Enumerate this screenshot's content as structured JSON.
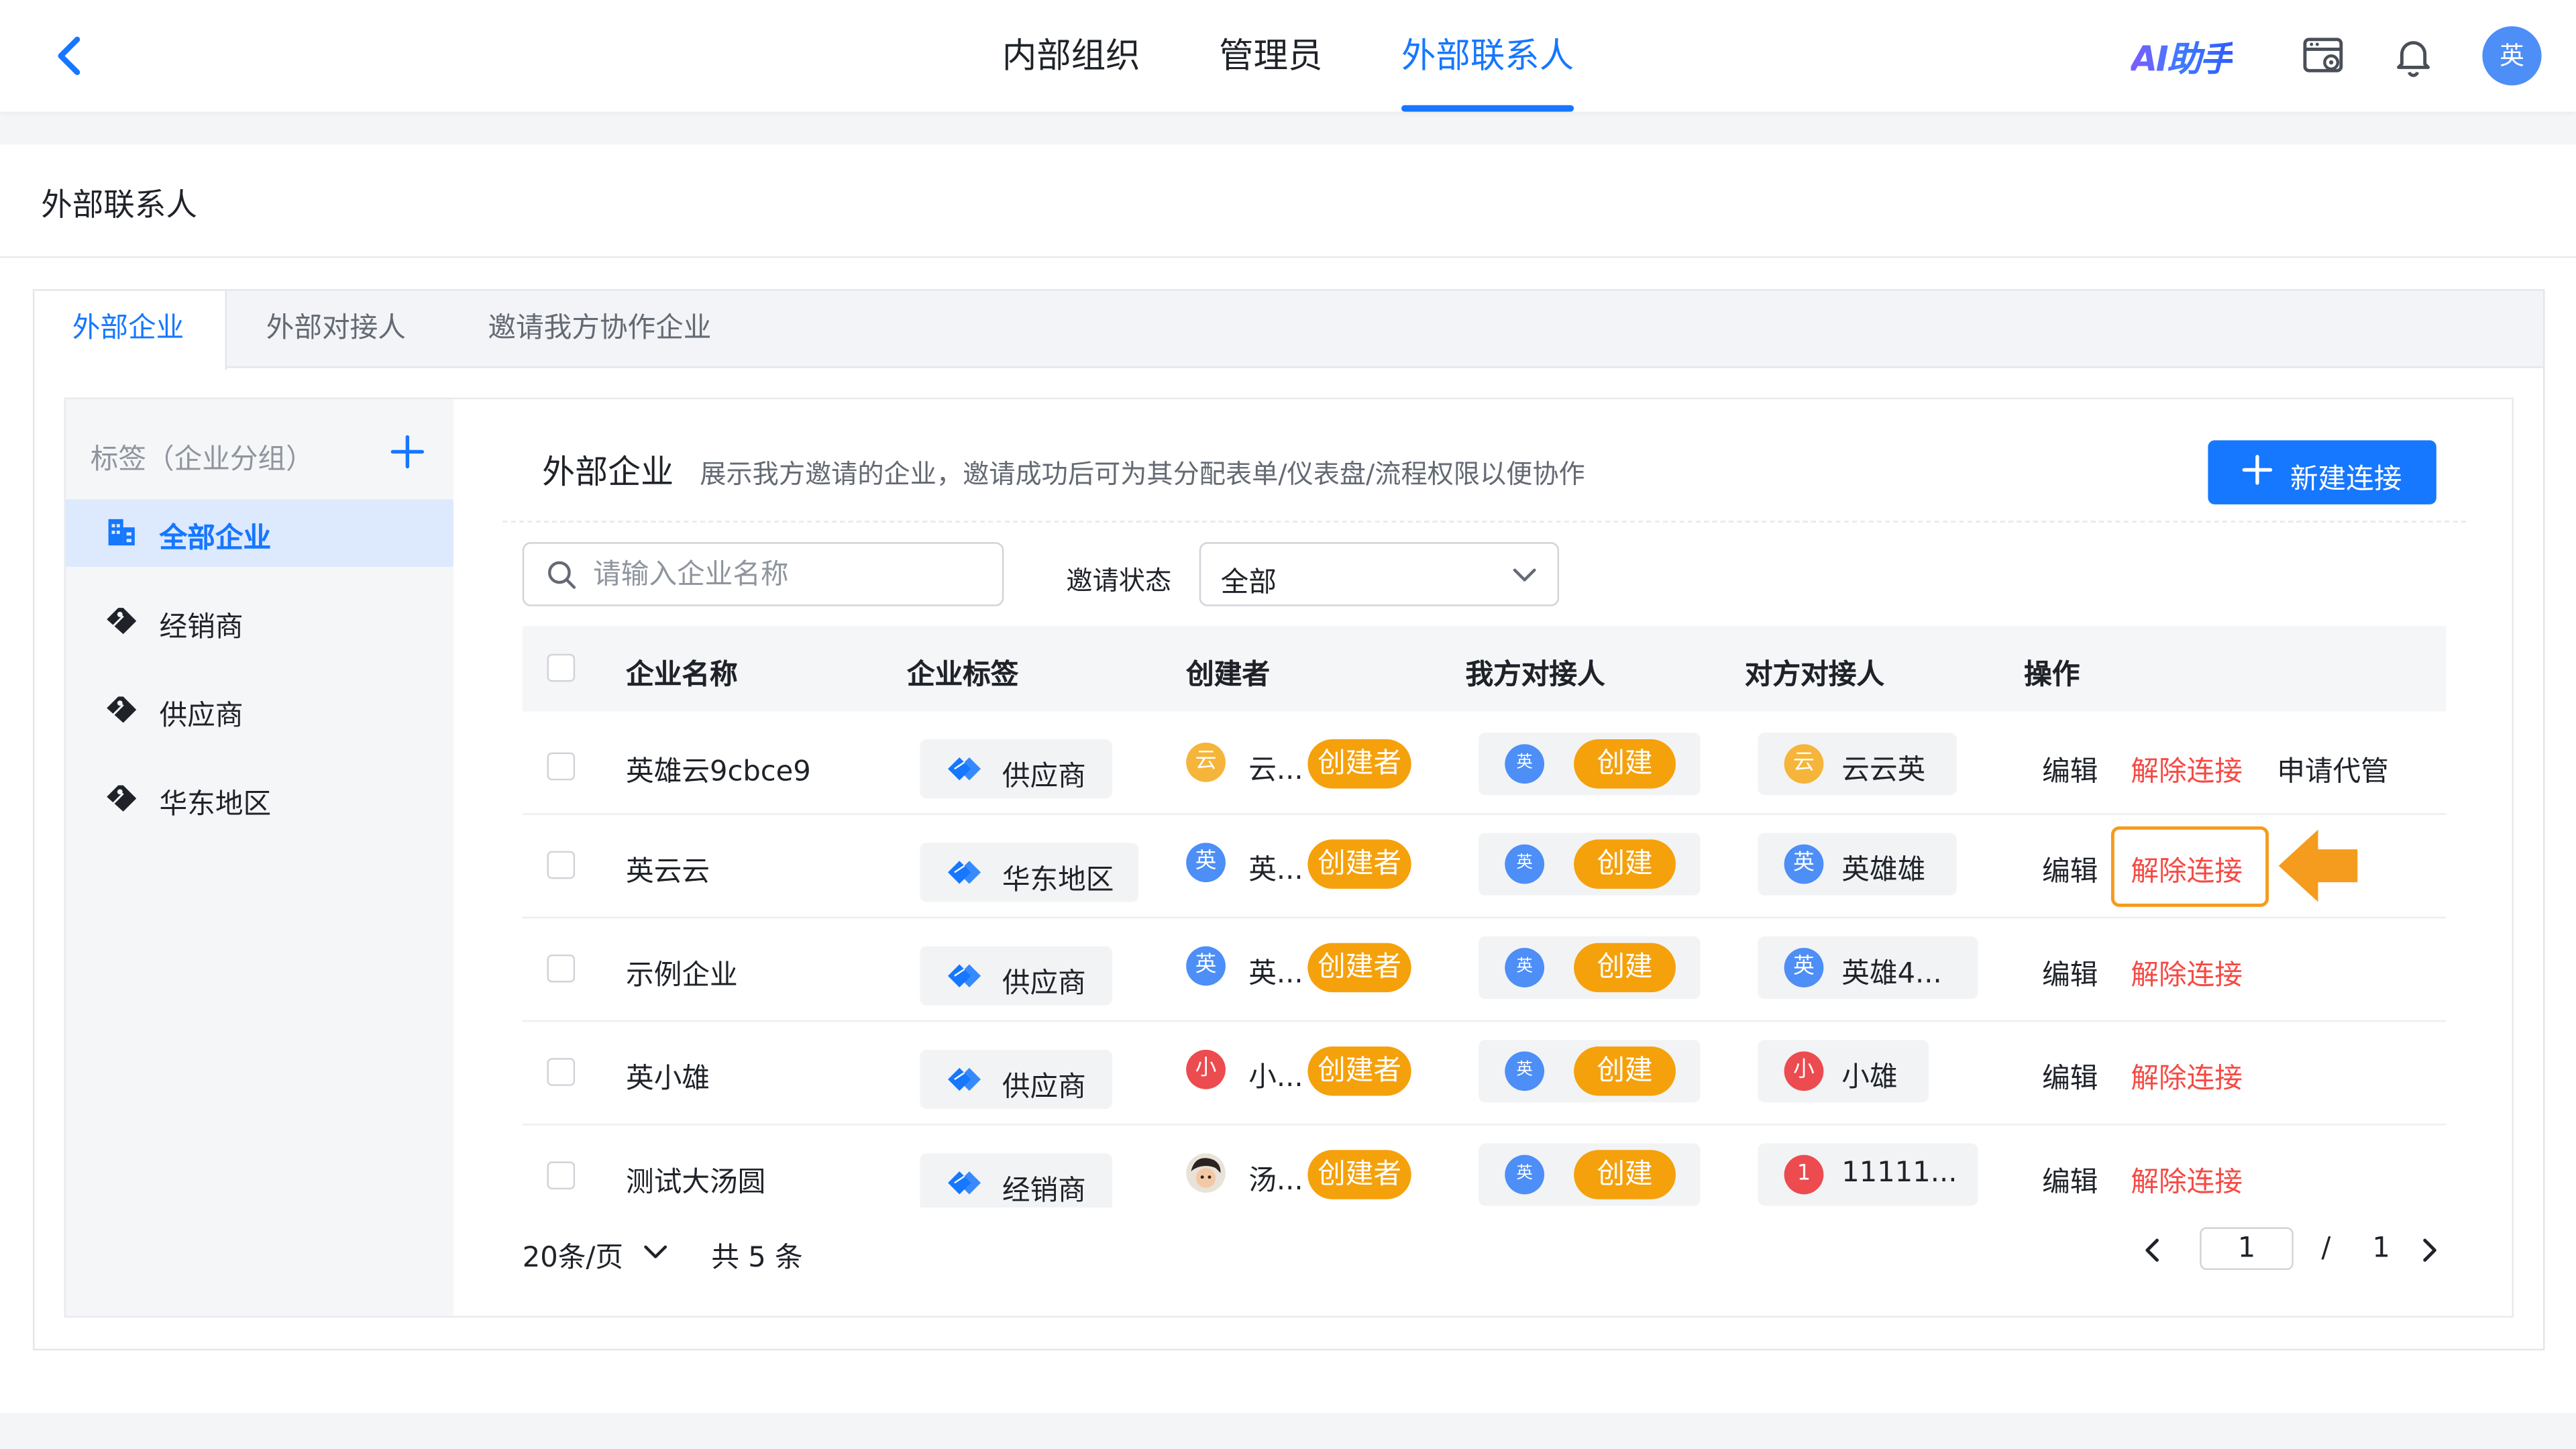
{
  "topbar": {
    "nav": [
      "内部组织",
      "管理员",
      "外部联系人"
    ],
    "active_nav": "外部联系人",
    "ai_label": "AI助手",
    "user_avatar": "英"
  },
  "page": {
    "title": "外部联系人",
    "tabs": [
      "外部企业",
      "外部对接人",
      "邀请我方协作企业"
    ]
  },
  "sidebar": {
    "header": "标签（企业分组）",
    "items": [
      "全部企业",
      "经销商",
      "供应商",
      "华东地区"
    ]
  },
  "section": {
    "title": "外部企业",
    "desc": "展示我方邀请的企业，邀请成功后可为其分配表单/仪表盘/流程权限以便协作",
    "new_button": "新建连接"
  },
  "filters": {
    "search_placeholder": "请输入企业名称",
    "status_label": "邀请状态",
    "status_value": "全部"
  },
  "table": {
    "headers": [
      "企业名称",
      "企业标签",
      "创建者",
      "我方对接人",
      "对方对接人",
      "操作"
    ],
    "rows": [
      {
        "name": "英雄云9cbce9",
        "tag": "供应商",
        "creator_avatar": "云",
        "creator": "云...",
        "creator_badge": "创建者",
        "mine_avatar": "英",
        "mine_badge": "创建",
        "theirs_avatar": "云",
        "theirs": "云云英",
        "ops": [
          "编辑",
          "解除连接",
          "申请代管"
        ]
      },
      {
        "name": "英云云",
        "tag": "华东地区",
        "creator_avatar": "英",
        "creator": "英...",
        "creator_badge": "创建者",
        "mine_avatar": "英",
        "mine_badge": "创建",
        "theirs_avatar": "英",
        "theirs": "英雄雄",
        "ops": [
          "编辑",
          "解除连接"
        ]
      },
      {
        "name": "示例企业",
        "tag": "供应商",
        "creator_avatar": "英",
        "creator": "英...",
        "creator_badge": "创建者",
        "mine_avatar": "英",
        "mine_badge": "创建",
        "theirs_avatar": "英",
        "theirs": "英雄4...",
        "ops": [
          "编辑",
          "解除连接"
        ]
      },
      {
        "name": "英小雄",
        "tag": "供应商",
        "creator_avatar": "小",
        "creator": "小...",
        "creator_badge": "创建者",
        "mine_avatar": "英",
        "mine_badge": "创建",
        "theirs_avatar": "小",
        "theirs": "小雄",
        "ops": [
          "编辑",
          "解除连接"
        ]
      },
      {
        "name": "测试大汤圆",
        "tag": "经销商",
        "creator_avatar": "",
        "creator": "汤...",
        "creator_badge": "创建者",
        "mine_avatar": "英",
        "mine_badge": "创建",
        "theirs_avatar": "1",
        "theirs": "11111...",
        "ops": [
          "编辑",
          "解除连接"
        ]
      }
    ]
  },
  "pager": {
    "page_size": "20条/页",
    "total": "共 5 条",
    "current": "1",
    "separator": "/",
    "pages": "1"
  },
  "colors": {
    "primary": "#1677ff",
    "danger": "#f54a45",
    "badge": "#f5a10c",
    "highlight": "#f59b1e",
    "avatar_blue": "#4d8ef7",
    "avatar_yellow": "#f5b53a",
    "avatar_red": "#ec4b4f"
  }
}
